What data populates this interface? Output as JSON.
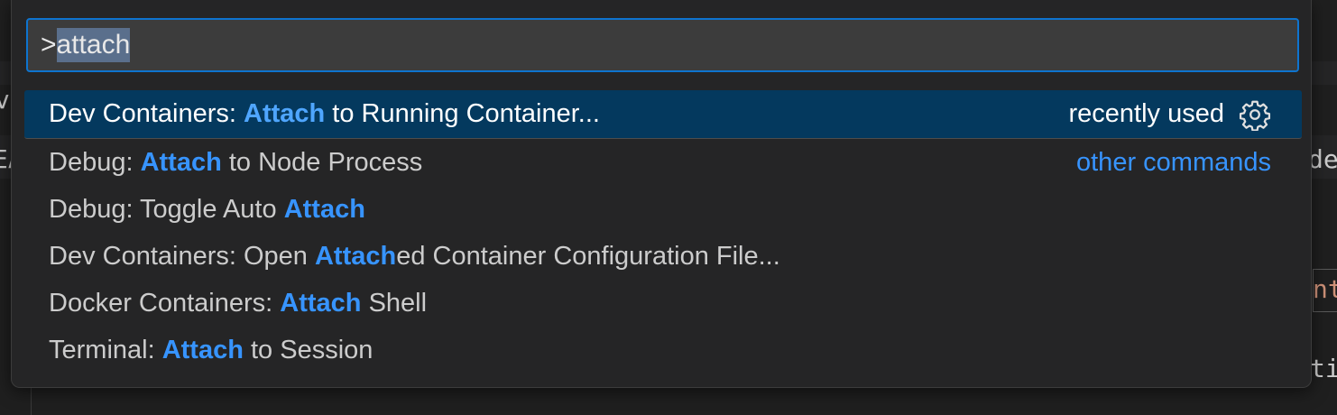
{
  "background": {
    "fragments": [
      "vo",
      "EA",
      "de",
      "nt",
      "ti"
    ]
  },
  "quick_open": {
    "prefix": ">",
    "query": "attach",
    "items": [
      {
        "segments": [
          {
            "text": "Dev Containers: ",
            "highlight": false
          },
          {
            "text": "Attach",
            "highlight": true
          },
          {
            "text": " to Running Container...",
            "highlight": false
          }
        ],
        "badge": "recently used",
        "selected": true
      },
      {
        "segments": [
          {
            "text": "Debug: ",
            "highlight": false
          },
          {
            "text": "Attach",
            "highlight": true
          },
          {
            "text": " to Node Process",
            "highlight": false
          }
        ],
        "badge": "other commands",
        "selected": false
      },
      {
        "segments": [
          {
            "text": "Debug: Toggle Auto ",
            "highlight": false
          },
          {
            "text": "Attach",
            "highlight": true
          }
        ],
        "selected": false
      },
      {
        "segments": [
          {
            "text": "Dev Containers: Open ",
            "highlight": false
          },
          {
            "text": "Attach",
            "highlight": true
          },
          {
            "text": "ed Container Configuration File...",
            "highlight": false
          }
        ],
        "selected": false
      },
      {
        "segments": [
          {
            "text": "Docker Containers: ",
            "highlight": false
          },
          {
            "text": "Attach",
            "highlight": true
          },
          {
            "text": " Shell",
            "highlight": false
          }
        ],
        "selected": false
      },
      {
        "segments": [
          {
            "text": "Terminal: ",
            "highlight": false
          },
          {
            "text": "Attach",
            "highlight": true
          },
          {
            "text": " to Session",
            "highlight": false
          }
        ],
        "selected": false
      }
    ]
  },
  "colors": {
    "accent": "#3794ff",
    "selection": "#04395e",
    "focus_border": "#0e74cf"
  },
  "icons": {
    "configure": "gear-icon"
  }
}
